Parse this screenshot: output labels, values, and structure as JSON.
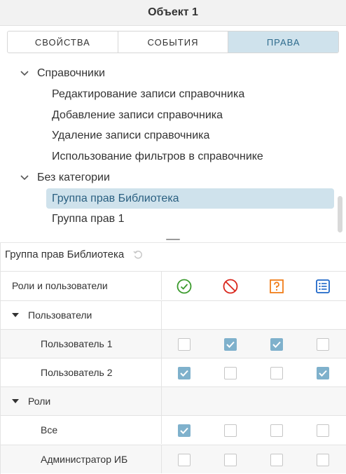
{
  "window": {
    "title": "Объект 1"
  },
  "tabs": [
    {
      "label": "СВОЙСТВА",
      "active": false
    },
    {
      "label": "СОБЫТИЯ",
      "active": false
    },
    {
      "label": "ПРАВА",
      "active": true
    }
  ],
  "tree": {
    "groups": [
      {
        "label": "Справочники",
        "expanded": true,
        "items": [
          "Редактирование записи справочника",
          "Добавление записи справочника",
          "Удаление записи справочника",
          "Использование фильтров в справочнике"
        ]
      },
      {
        "label": "Без категории",
        "expanded": true,
        "items": [
          "Группа прав Библиотека",
          "Группа прав 1"
        ]
      }
    ],
    "selected": "Группа прав Библиотека"
  },
  "permissions": {
    "title": "Группа прав Библиотека",
    "column_header": "Роли и пользователи",
    "columns": [
      {
        "icon": "allow-check-icon",
        "color": "#3a9a2c"
      },
      {
        "icon": "deny-forbidden-icon",
        "color": "#d9261c"
      },
      {
        "icon": "question-icon",
        "color": "#f07d1a"
      },
      {
        "icon": "list-icon",
        "color": "#1e67c8"
      }
    ],
    "rows": [
      {
        "type": "group",
        "label": "Пользователи"
      },
      {
        "type": "entry",
        "label": "Пользователь 1",
        "values": [
          false,
          true,
          true,
          false
        ]
      },
      {
        "type": "entry",
        "label": "Пользователь 2",
        "values": [
          true,
          false,
          false,
          true
        ]
      },
      {
        "type": "group",
        "label": "Роли"
      },
      {
        "type": "entry",
        "label": "Все",
        "values": [
          true,
          false,
          false,
          false
        ]
      },
      {
        "type": "entry",
        "label": "Администратор ИБ",
        "values": [
          false,
          false,
          false,
          false
        ]
      }
    ]
  },
  "colors": {
    "accent": "#cfe2ec",
    "checkbox_on": "#7fb1cc"
  }
}
